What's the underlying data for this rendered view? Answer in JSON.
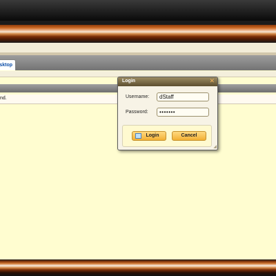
{
  "tab": {
    "label": "sktop"
  },
  "content": {
    "fragment_text": "nd."
  },
  "dialog": {
    "title": "Login",
    "close_icon": "close-icon",
    "username_label": "Username:",
    "username_value": "dStaff",
    "password_label": "Password:",
    "password_value": "•••••••",
    "login_label": "Login",
    "login_icon": "login-icon",
    "cancel_label": "Cancel"
  },
  "colors": {
    "accent_orange": "#c8641e",
    "background_cream": "#fffdd0",
    "button_gold": "#f3b035",
    "tab_text_blue": "#0c4ea8"
  }
}
